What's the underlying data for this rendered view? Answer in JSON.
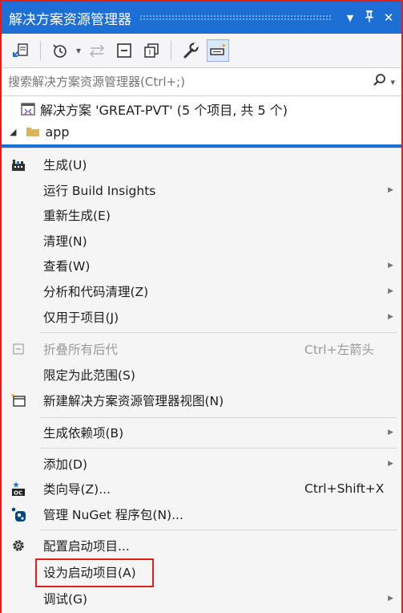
{
  "titlebar": {
    "title": "解决方案资源管理器",
    "dropdown_glyph": "▼",
    "pin_glyph": "ᛘ",
    "close_glyph": "✕"
  },
  "toolbar": {
    "icons": [
      "sync-view-icon",
      "history-icon",
      "back-forward-icon",
      "collapse-all-icon",
      "show-all-files-icon",
      "properties-wrench-icon",
      "preview-selected-icon"
    ],
    "history_dropdown_glyph": "▾"
  },
  "search": {
    "placeholder": "搜索解决方案资源管理器(Ctrl+;)",
    "icon_glyph": "⚲",
    "dropdown_glyph": "▾"
  },
  "tree": {
    "solution_label": "解决方案 'GREAT-PVT' (5 个项目, 共 5 个)",
    "project_label": "app",
    "expand_glyph": "◢"
  },
  "menu": {
    "arrow_glyph": "▶",
    "items": [
      {
        "label": "生成(U)",
        "icon": "build-icon"
      },
      {
        "label": "运行 Build Insights",
        "submenu": true
      },
      {
        "label": "重新生成(E)"
      },
      {
        "label": "清理(N)"
      },
      {
        "label": "查看(W)",
        "submenu": true
      },
      {
        "label": "分析和代码清理(Z)",
        "submenu": true
      },
      {
        "label": "仅用于项目(J)",
        "submenu": true
      },
      {
        "label": "折叠所有后代",
        "shortcut": "Ctrl+左箭头",
        "disabled": true,
        "icon": "collapse-icon"
      },
      {
        "label": "限定为此范围(S)"
      },
      {
        "label": "新建解决方案资源管理器视图(N)",
        "icon": "new-view-icon"
      },
      {
        "label": "生成依赖项(B)",
        "submenu": true
      },
      {
        "label": "添加(D)",
        "submenu": true
      },
      {
        "label": "类向导(Z)...",
        "shortcut": "Ctrl+Shift+X",
        "icon": "class-wizard-icon"
      },
      {
        "label": "管理 NuGet 程序包(N)...",
        "icon": "nuget-icon"
      },
      {
        "label": "配置启动项目...",
        "icon": "gear-icon"
      },
      {
        "label": "设为启动项目(A)",
        "highlighted": true
      },
      {
        "label": "调试(G)",
        "submenu": true
      }
    ]
  },
  "colors": {
    "accent": "#1d6fd6",
    "highlight_border": "#e02020",
    "menu_bg": "#f5f5f5"
  }
}
